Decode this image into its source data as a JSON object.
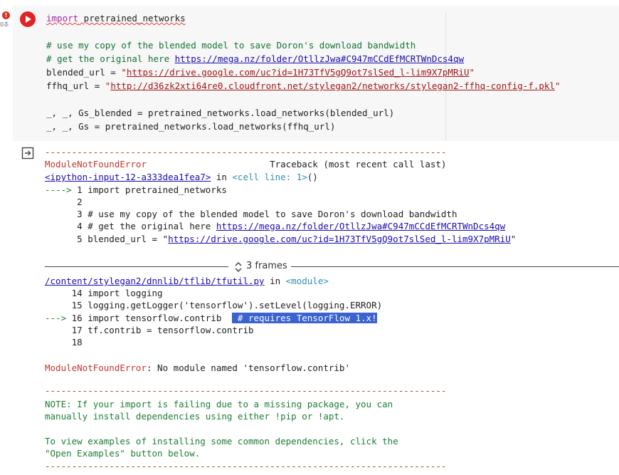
{
  "gutter": {
    "error_badge": "!",
    "exec_time": "0초"
  },
  "code": {
    "line1": {
      "kw": "import",
      "rest": " pretrained_networks"
    },
    "line2": "# use my copy of the blended model to save Doron's download bandwidth",
    "line3": {
      "prefix": "# get the original here ",
      "url": "https://mega.nz/folder/OtllzJwa#C947mCCdEfMCRTWnDcs4qw"
    },
    "line4": {
      "prefix": "blended_url = ",
      "q1": "\"",
      "url": "https://drive.google.com/uc?id=1H73TfV5gQ9ot7slSed_l-lim9X7pMRiU",
      "q2": "\""
    },
    "line5": {
      "prefix": "ffhq_url = ",
      "q1": "\"",
      "url": "http://d36zk2xti64re0.cloudfront.net/stylegan2/networks/stylegan2-ffhq-config-f.pkl",
      "q2": "\""
    },
    "line6": "_, _, Gs_blended = pretrained_networks.load_networks(blended_url)",
    "line7": "_, _, Gs = pretrained_networks.load_networks(ffhq_url)"
  },
  "output": {
    "rule": "---------------------------------------------------------------------------",
    "err_name": "ModuleNotFoundError",
    "traceback_pad": "                       ",
    "traceback": "Traceback (most recent call last)",
    "loc1_link": "<ipython-input-12-a333dea1fea7>",
    "loc1_in": " in ",
    "loc1_cell": "<cell line: 1>",
    "loc1_paren": "()",
    "t1": "----> 1 import pretrained_networks",
    "t2": "      2",
    "t3": "      3 # use my copy of the blended model to save Doron's download bandwidth",
    "t4a": "      4 # get the original here ",
    "t4url": "https://mega.nz/folder/OtllzJwa#C947mCCdEfMCRTWnDcs4qw",
    "t5a": "      5 blended_url = \"",
    "t5url": "https://drive.google.com/uc?id=1H73TfV5gQ9ot7slSed_l-lim9X7pMRiU",
    "t5b": "\"",
    "frames": "3 frames",
    "loc2_link": "/content/stylegan2/dnnlib/tflib/tfutil.py",
    "loc2_in": " in ",
    "loc2_mod": "<module>",
    "u14": "     14 import logging",
    "u15": "     15 logging.getLogger('tensorflow').setLevel(logging.ERROR)",
    "u16a": "---> 16 import tensorflow.contrib  ",
    "u16sel": " # requires TensorFlow 1.x!",
    "u17": "     17 tf.contrib = tensorflow.contrib",
    "u18": "     18",
    "final_name": "ModuleNotFoundError",
    "final_msg": ": No module named 'tensorflow.contrib'",
    "note1": "NOTE: If your import is failing due to a missing package, you can",
    "note2": "manually install dependencies using either !pip or !apt.",
    "note3": "To view examples of installing some common dependencies, click the",
    "note4": "\"Open Examples\" button below."
  }
}
